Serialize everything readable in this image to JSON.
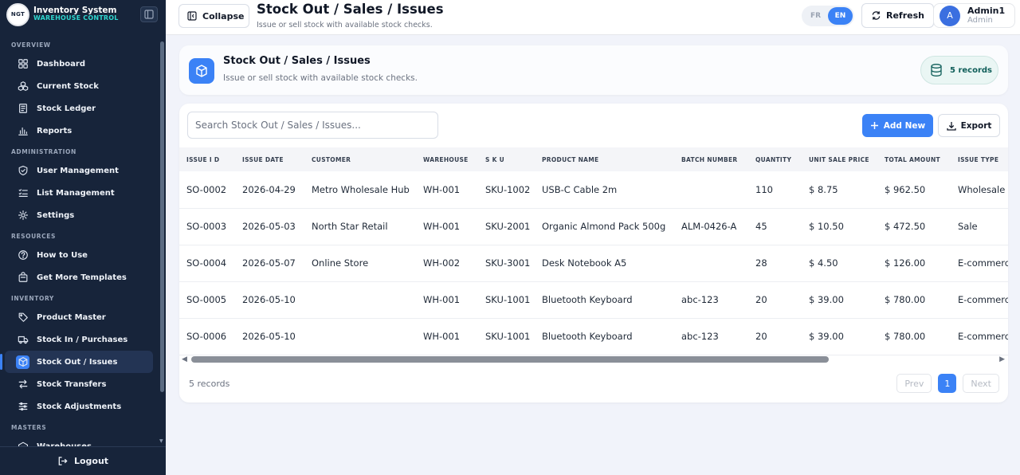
{
  "app": {
    "logo_text": "NGT",
    "title": "Inventory System",
    "subtitle": "WAREHOUSE CONTROL"
  },
  "sidebar": {
    "sections": [
      {
        "title": "OVERVIEW",
        "items": [
          {
            "label": "Dashboard",
            "icon": "grid-icon",
            "active": false
          },
          {
            "label": "Current Stock",
            "icon": "boxes-icon",
            "active": false
          },
          {
            "label": "Stock Ledger",
            "icon": "ledger-icon",
            "active": false
          },
          {
            "label": "Reports",
            "icon": "bar-chart-icon",
            "active": false
          }
        ]
      },
      {
        "title": "ADMINISTRATION",
        "items": [
          {
            "label": "User Management",
            "icon": "shield-icon",
            "active": false
          },
          {
            "label": "List Management",
            "icon": "list-icon",
            "active": false
          },
          {
            "label": "Settings",
            "icon": "gear-icon",
            "active": false
          }
        ]
      },
      {
        "title": "RESOURCES",
        "items": [
          {
            "label": "How to Use",
            "icon": "help-icon",
            "active": false
          },
          {
            "label": "Get More Templates",
            "icon": "bag-icon",
            "active": false
          }
        ]
      },
      {
        "title": "INVENTORY",
        "items": [
          {
            "label": "Product Master",
            "icon": "tag-icon",
            "active": false
          },
          {
            "label": "Stock In / Purchases",
            "icon": "truck-icon",
            "active": false
          },
          {
            "label": "Stock Out / Issues",
            "icon": "box-out-icon",
            "active": true
          },
          {
            "label": "Stock Transfers",
            "icon": "transfer-icon",
            "active": false
          },
          {
            "label": "Stock Adjustments",
            "icon": "sliders-icon",
            "active": false
          }
        ]
      },
      {
        "title": "MASTERS",
        "items": [
          {
            "label": "Warehouses",
            "icon": "warehouse-icon",
            "active": false
          }
        ]
      }
    ],
    "logout_label": "Logout"
  },
  "topbar": {
    "collapse_label": "Collapse",
    "title": "Stock Out / Sales / Issues",
    "subtitle": "Issue or sell stock with available stock checks.",
    "lang_options": [
      "FR",
      "EN"
    ],
    "lang_selected": "EN",
    "refresh_label": "Refresh",
    "user_initial": "A",
    "user_name": "Admin1",
    "user_role": "Admin"
  },
  "header_card": {
    "title": "Stock Out / Sales / Issues",
    "subtitle": "Issue or sell stock with available stock checks.",
    "records_label": "5 records"
  },
  "table_card": {
    "search_placeholder": "Search Stock Out / Sales / Issues...",
    "add_label": "Add New",
    "export_label": "Export",
    "columns": [
      "ISSUE I D",
      "ISSUE DATE",
      "CUSTOMER",
      "WAREHOUSE",
      "S K U",
      "PRODUCT NAME",
      "BATCH NUMBER",
      "QUANTITY",
      "UNIT SALE PRICE",
      "TOTAL AMOUNT",
      "ISSUE TYPE"
    ],
    "rows": [
      [
        "SO-0002",
        "2026-04-29",
        "Metro Wholesale Hub",
        "WH-001",
        "SKU-1002",
        "USB-C Cable 2m",
        "",
        "110",
        "$ 8.75",
        "$ 962.50",
        "Wholesale"
      ],
      [
        "SO-0003",
        "2026-05-03",
        "North Star Retail",
        "WH-001",
        "SKU-2001",
        "Organic Almond Pack 500g",
        "ALM-0426-A",
        "45",
        "$ 10.50",
        "$ 472.50",
        "Sale"
      ],
      [
        "SO-0004",
        "2026-05-07",
        "Online Store",
        "WH-002",
        "SKU-3001",
        "Desk Notebook A5",
        "",
        "28",
        "$ 4.50",
        "$ 126.00",
        "E-commerce"
      ],
      [
        "SO-0005",
        "2026-05-10",
        "",
        "WH-001",
        "SKU-1001",
        "Bluetooth Keyboard",
        "abc-123",
        "20",
        "$ 39.00",
        "$ 780.00",
        "E-commerce"
      ],
      [
        "SO-0006",
        "2026-05-10",
        "",
        "WH-001",
        "SKU-1001",
        "Bluetooth Keyboard",
        "abc-123",
        "20",
        "$ 39.00",
        "$ 780.00",
        "E-commerce"
      ]
    ],
    "footer_count": "5 records",
    "pager": {
      "prev": "Prev",
      "current": "1",
      "next": "Next"
    }
  },
  "colors": {
    "sidebar_bg": "#17243a",
    "accent": "#3b82f6",
    "teal": "#2fd6cf"
  }
}
